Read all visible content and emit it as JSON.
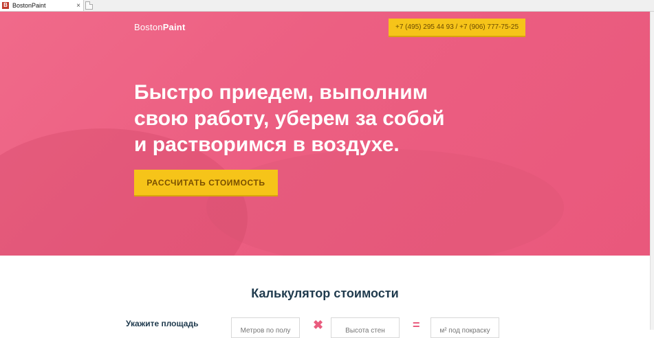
{
  "browser": {
    "tab_title": "BostonPaint",
    "favicon_letter": "B",
    "close_glyph": "×"
  },
  "header": {
    "logo_light": "Boston",
    "logo_bold": "Paint",
    "phone": "+7 (495) 295 44 93 / +7 (906) 777-75-25"
  },
  "hero": {
    "headline_line1": "Быстро приедем, выполним",
    "headline_line2": "свою работу, уберем за собой",
    "headline_line3": "и растворимся в воздухе.",
    "cta_label": "РАССЧИТАТЬ СТОИМОСТЬ",
    "accent_color": "#ec5f82",
    "button_color": "#f6c419"
  },
  "calculator": {
    "title": "Калькулятор стоимости",
    "area_label": "Укажите площадь",
    "field1_placeholder": "Метров по полу",
    "field2_placeholder": "Высота стен",
    "field3_placeholder": "м² под покраску",
    "multiply_glyph": "✖",
    "equals_glyph": "="
  }
}
